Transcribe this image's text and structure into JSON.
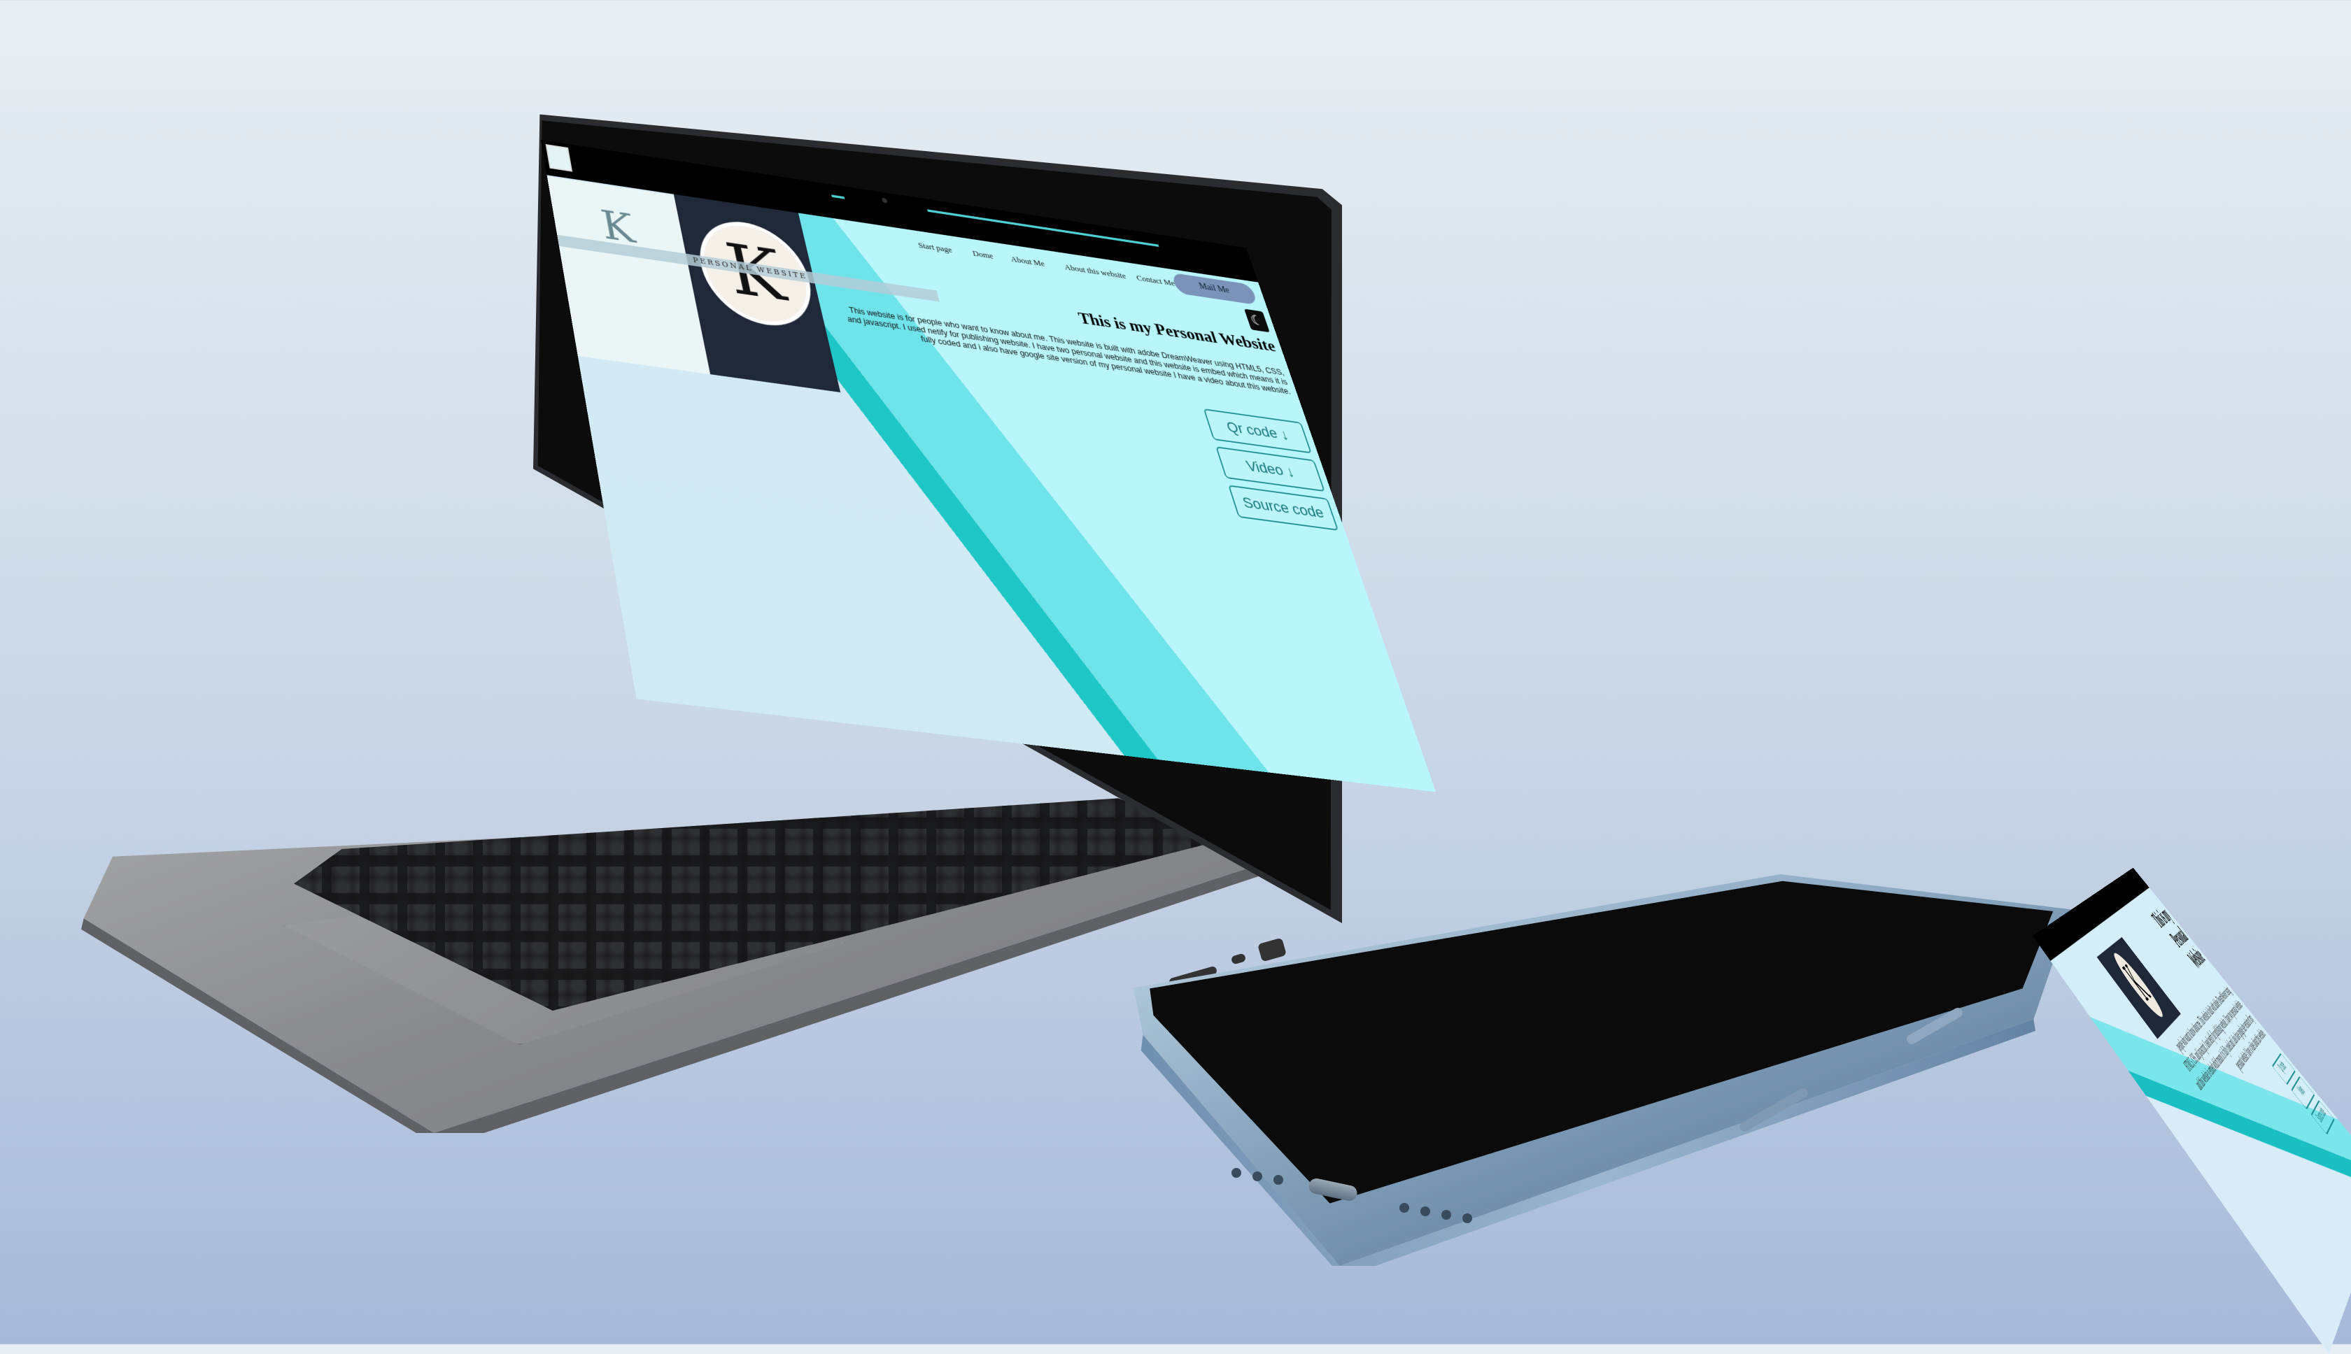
{
  "site": {
    "nav": {
      "items": [
        "Start page",
        "Dome",
        "About Me",
        "About this website",
        "Contact Me"
      ],
      "mail_button": "Mail Me",
      "theme_icon": "moon-icon"
    },
    "logo": {
      "letter": "K",
      "band_text": "PERSONAL WEBSITE",
      "band_text_small": "< PERSONAL WEBSITE >"
    },
    "title": "This is my Personal Website",
    "description": "This website is for people who want to know about me. This website is built with adobe DreamWeaver using HTML5, CSS, and javascript. I used netify for publishing website. I have two personal website and this website is embed which means it is fully coded and i also have google site version of my personal website I have a video about this website.",
    "buttons": {
      "qr": "Qr code ↓",
      "video": "Video ↓",
      "source": "Source code"
    }
  },
  "phone_site": {
    "title_lines": [
      "This is my",
      "Personal",
      "Website"
    ],
    "description": "people who want to know about me. This website is built with adobe DreamWeaver using HTML5, CSS, and javascript. I used netify for publishing website. I have two personal website and this website is embed which means it is fully coded and i also have google site version of my personal website I have a video about this website.",
    "buttons": [
      "Qr code",
      "Video",
      "Source code"
    ],
    "logo_letter": "K"
  },
  "colors": {
    "accent": "#1d8c8f",
    "nav_bg": "#000000",
    "mail_btn": "#7b93b9",
    "cyan": "#1fc6c6"
  }
}
